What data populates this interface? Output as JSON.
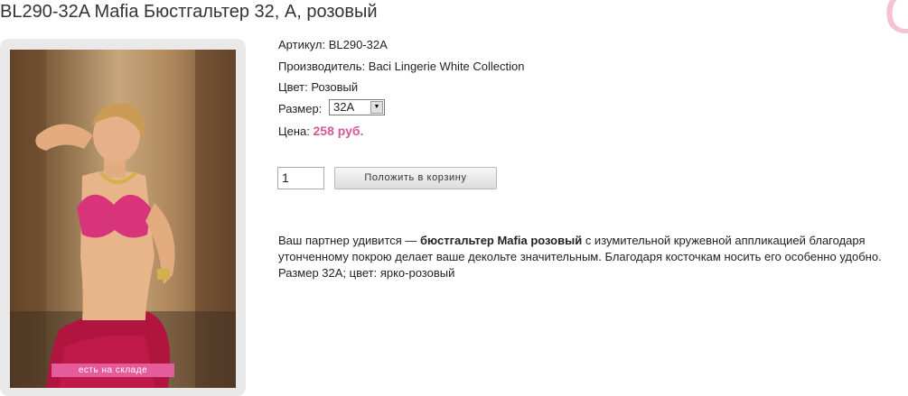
{
  "product": {
    "title": "BL290-32A Mafia Бюстгальтер 32, A, розовый",
    "corner_glyph": "C",
    "stock_badge": "есть на складе",
    "article_label": "Артикул:",
    "article_value": "BL290-32A",
    "manufacturer_label": "Производитель:",
    "manufacturer_value": "Baci Lingerie White Collection",
    "color_label": "Цвет:",
    "color_value": "Розовый",
    "size_label": "Размер:",
    "size_selected": "32A",
    "price_label": "Цена:",
    "price_value": "258 руб.",
    "quantity": "1",
    "add_to_cart_label": "Положить в корзину"
  },
  "description": {
    "part1": "Ваш партнер удивится — ",
    "bold": "бюстгальтер Mafia розовый",
    "part2": " с изумительной кружевной аппликацией благодаря утонченному покрою делает ваше декольте значительным. Благодаря косточкам носить его особенно удобно. Размер 32A; цвет: ярко-розовый"
  },
  "colors": {
    "price": "#d6569a",
    "badge": "#e45c9a",
    "garment": "#d8347a"
  },
  "icons": {
    "select_arrow": "triangle-down"
  }
}
